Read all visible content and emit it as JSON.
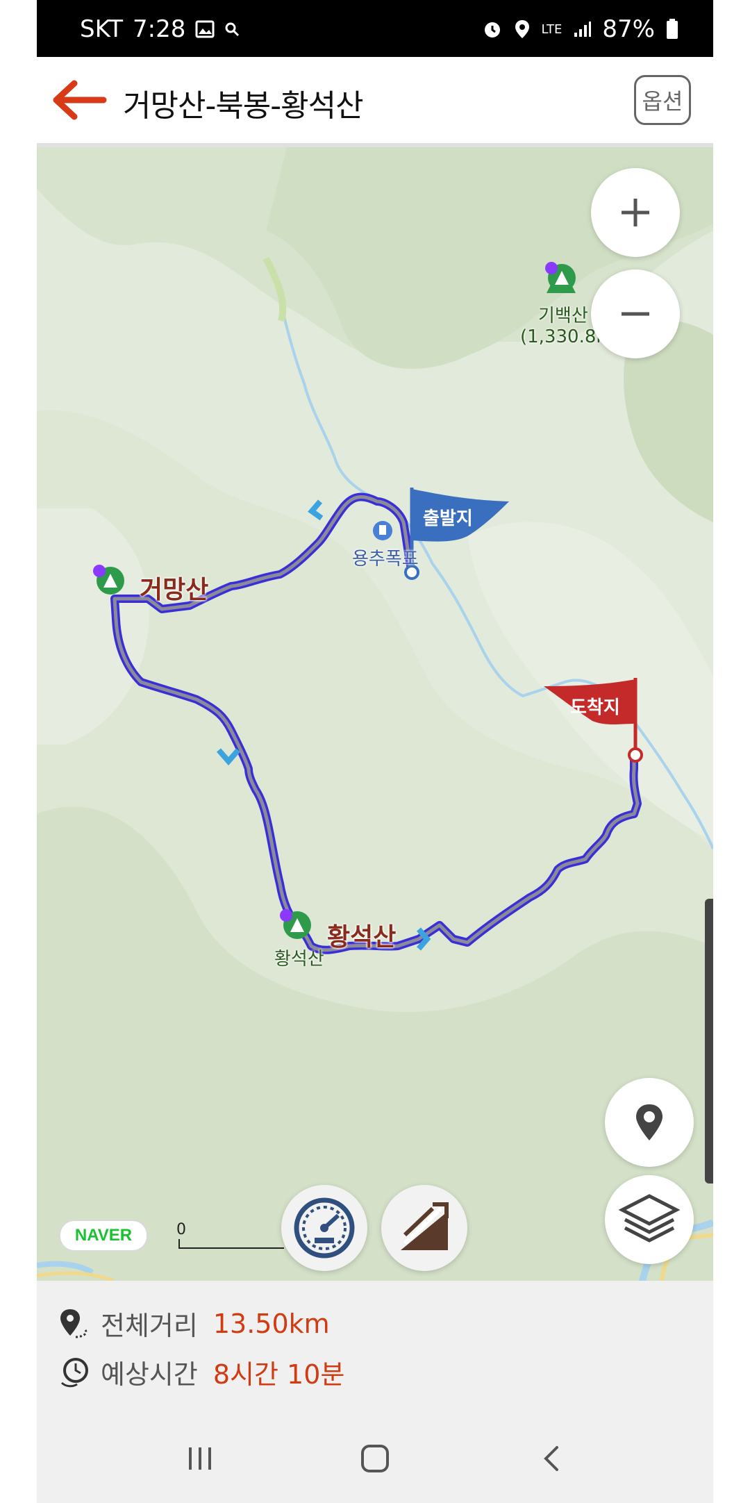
{
  "status_bar": {
    "carrier": "SKT",
    "time": "7:28",
    "battery": "87%",
    "network": "LTE",
    "icons": [
      "gallery-icon",
      "search-icon",
      "alarm-icon",
      "location-icon",
      "signal-icon",
      "battery-icon"
    ]
  },
  "header": {
    "title": "거망산-북봉-황석산",
    "option_label": "옵션"
  },
  "map": {
    "labels": {
      "geomangsan": "거망산",
      "hwangseoksan_big": "황석산",
      "hwangseoksan_small": "황석산",
      "yongchu": "용추폭포",
      "gibaeksan": "기백산",
      "gibaeksan_height": "(1,330.8m)",
      "start_flag": "출발지",
      "end_flag": "도착지"
    },
    "brand": "NAVER",
    "scale_zero": "0",
    "colors": {
      "route": "#3a2fd6",
      "route_inner": "#8a8a9a",
      "start_flag": "#3a6fc0",
      "end_flag": "#c52a2a",
      "water": "#a9d2ec",
      "base": "#e2eadb"
    }
  },
  "info": {
    "distance_label": "전체거리",
    "distance_value": "13.50km",
    "time_label": "예상시간",
    "time_value": "8시간 10분"
  }
}
